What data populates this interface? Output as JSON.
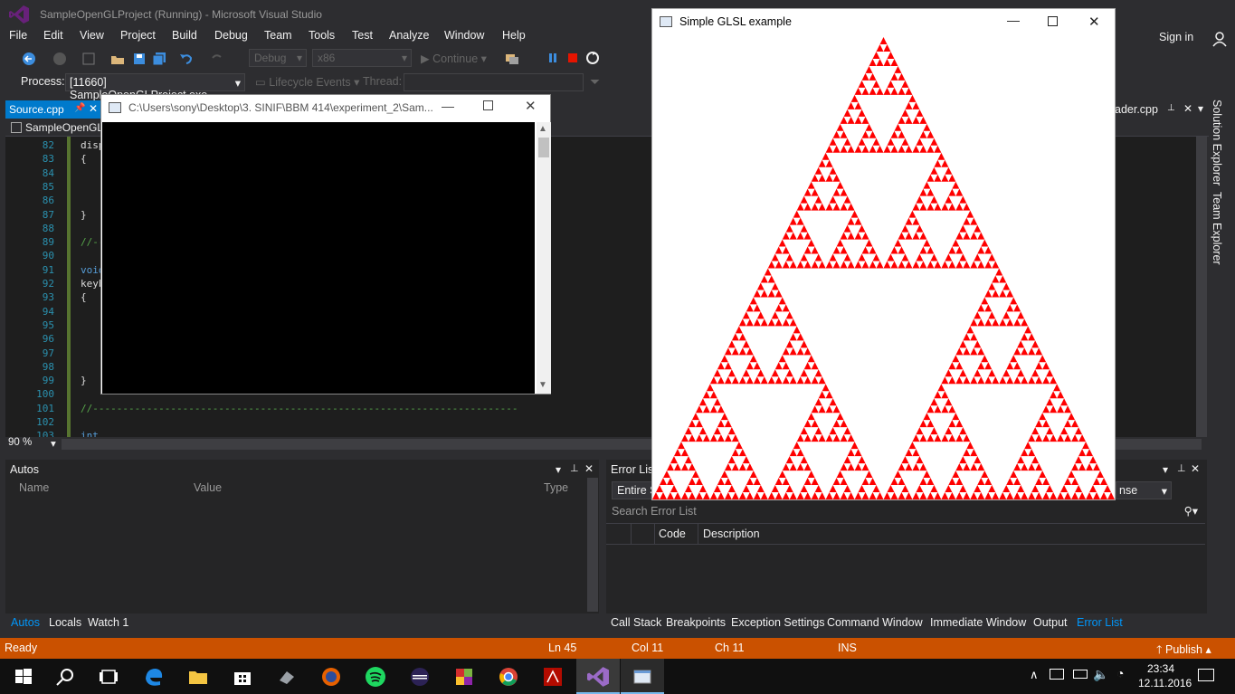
{
  "vs": {
    "title": "SampleOpenGLProject (Running) - Microsoft Visual Studio",
    "menu": [
      "File",
      "Edit",
      "View",
      "Project",
      "Build",
      "Debug",
      "Team",
      "Tools",
      "Test",
      "Analyze",
      "Window",
      "Help"
    ],
    "sign_in": "Sign in",
    "toolbar": {
      "config": "Debug",
      "platform": "x86",
      "continue": "Continue"
    },
    "process_label": "Process:",
    "process_value": "[11660] SampleOpenGLProject.exe",
    "lifecycle": "Lifecycle Events",
    "thread_label": "Thread:",
    "tab_source": "Source.cpp",
    "tab_right": "ader.cpp",
    "nav_project": "SampleOpenGL",
    "zoom": "90 %",
    "editor_lines": [
      {
        "n": "82",
        "t": "disp"
      },
      {
        "n": "83",
        "t": "{"
      },
      {
        "n": "84",
        "t": ""
      },
      {
        "n": "85",
        "t": ""
      },
      {
        "n": "86",
        "t": ""
      },
      {
        "n": "87",
        "t": "}"
      },
      {
        "n": "88",
        "t": ""
      },
      {
        "n": "89",
        "t": "//--"
      },
      {
        "n": "90",
        "t": ""
      },
      {
        "n": "91",
        "t": "void"
      },
      {
        "n": "92",
        "t": "keyb"
      },
      {
        "n": "93",
        "t": "{"
      },
      {
        "n": "94",
        "t": ""
      },
      {
        "n": "95",
        "t": ""
      },
      {
        "n": "96",
        "t": ""
      },
      {
        "n": "97",
        "t": ""
      },
      {
        "n": "98",
        "t": ""
      },
      {
        "n": "99",
        "t": "}"
      },
      {
        "n": "100",
        "t": ""
      },
      {
        "n": "101",
        "t": "//-----------------------------------------------------------------------"
      },
      {
        "n": "102",
        "t": ""
      },
      {
        "n": "103",
        "t": "int"
      }
    ],
    "side_tabs": [
      "Solution Explorer",
      "Team Explorer"
    ],
    "autos": {
      "title": "Autos",
      "cols": [
        "Name",
        "Value",
        "Type"
      ]
    },
    "autos_tabs": [
      "Autos",
      "Locals",
      "Watch 1"
    ],
    "errors": {
      "title": "Error List",
      "scope": "Entire S",
      "build": "nse",
      "search": "Search Error List",
      "cols": [
        "Code",
        "Description"
      ]
    },
    "bottom_tabs": [
      "Call Stack",
      "Breakpoints",
      "Exception Settings",
      "Command Window",
      "Immediate Window",
      "Output",
      "Error List"
    ],
    "status": {
      "ready": "Ready",
      "ln": "Ln 45",
      "col": "Col 11",
      "ch": "Ch 11",
      "ins": "INS",
      "publish": "Publish"
    }
  },
  "console": {
    "title": "C:\\Users\\sony\\Desktop\\3. SINIF\\BBM 414\\experiment_2\\Sam..."
  },
  "glwin": {
    "title": "Simple GLSL example",
    "fill": "#ff0000"
  },
  "taskbar": {
    "time": "23:34",
    "date": "12.11.2016"
  },
  "colors": {
    "accent": "#007acc",
    "status": "#ca5100",
    "background": "#2d2d30"
  }
}
